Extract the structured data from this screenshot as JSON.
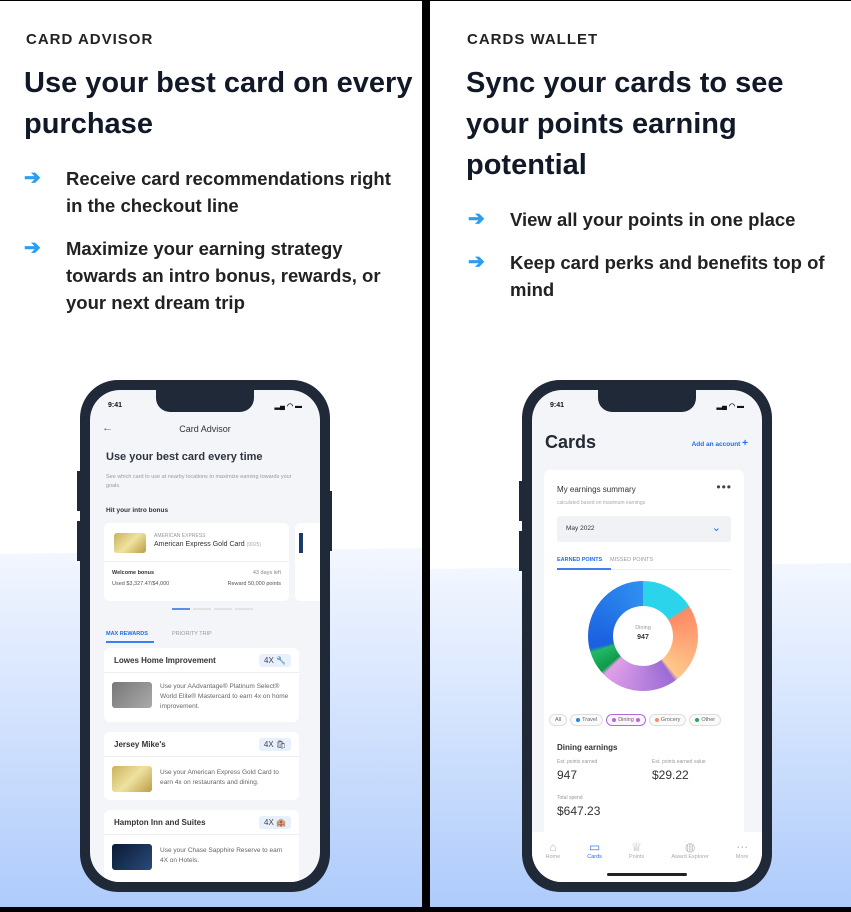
{
  "left": {
    "eyebrow": "CARD ADVISOR",
    "title": "Use your best card on every purchase",
    "bullets": [
      "Receive card recommendations right in the checkout line",
      "Maximize your earning strategy towards an intro bonus, rewards, or your next dream trip"
    ],
    "phone": {
      "time": "9:41",
      "header": "Card Advisor",
      "heading": "Use your best card every time",
      "subtext": "See which card to use at nearby locations to maximize earning towards your goals.",
      "section": "Hit your intro bonus",
      "bonus_card": {
        "issuer": "AMERICAN EXPRESS",
        "name": "American Express Gold Card",
        "last4": "(9925)",
        "label": "Welcome bonus",
        "days_left": "43 days left",
        "spend": "Used $3,327.47/$4,000",
        "reward": "Reward 50,000 points"
      },
      "tabs": [
        "MAX REWARDS",
        "PRIORITY TRIP"
      ],
      "offers": [
        {
          "merchant": "Lowes Home Improvement",
          "multiplier": "4X",
          "icon": "wrench-icon",
          "text": "Use your AAdvantage® Platinum Select® World Elite® Mastercard to earn 4x on home improvement."
        },
        {
          "merchant": "Jersey Mike's",
          "multiplier": "4X",
          "icon": "bag-icon",
          "text": "Use your American Express Gold Card to earn 4x on restaurants and dining."
        },
        {
          "merchant": "Hampton Inn and Suites",
          "multiplier": "4X",
          "icon": "hotel-icon",
          "text": "Use your Chase Sapphire Reserve to earn 4X on Hotels."
        }
      ]
    }
  },
  "right": {
    "eyebrow": "CARDS WALLET",
    "title": "Sync your cards to see your points earning potential",
    "bullets": [
      "View all your points in one place",
      "Keep card perks and benefits top of mind"
    ],
    "phone": {
      "time": "9:41",
      "heading": "Cards",
      "add_account": "Add an account",
      "summary_title": "My earnings summary",
      "summary_sub": "calculated based on maximum earnings",
      "month": "May 2022",
      "tabs": [
        "EARNED POINTS",
        "MISSED POINTS"
      ],
      "donut_label": "Dining",
      "donut_value": "947",
      "filters": [
        {
          "label": "All",
          "color": ""
        },
        {
          "label": "Travel",
          "color": "#1e88e5"
        },
        {
          "label": "Dining",
          "color": "#b36ad6"
        },
        {
          "label": "Grocery",
          "color": "#ff8a65"
        },
        {
          "label": "Other",
          "color": "#1fa855"
        }
      ],
      "earnings_title": "Dining earnings",
      "points_label": "Est. points earned",
      "points": "947",
      "value_label": "Est. points earned value",
      "value": "$29.22",
      "spend_label": "Total spend",
      "spend": "$647.23",
      "nav": [
        "Home",
        "Cards",
        "Points",
        "Award Explorer",
        "More"
      ]
    }
  },
  "colors": {
    "accent": "#2b9ef0",
    "link": "#1a6ef5"
  }
}
